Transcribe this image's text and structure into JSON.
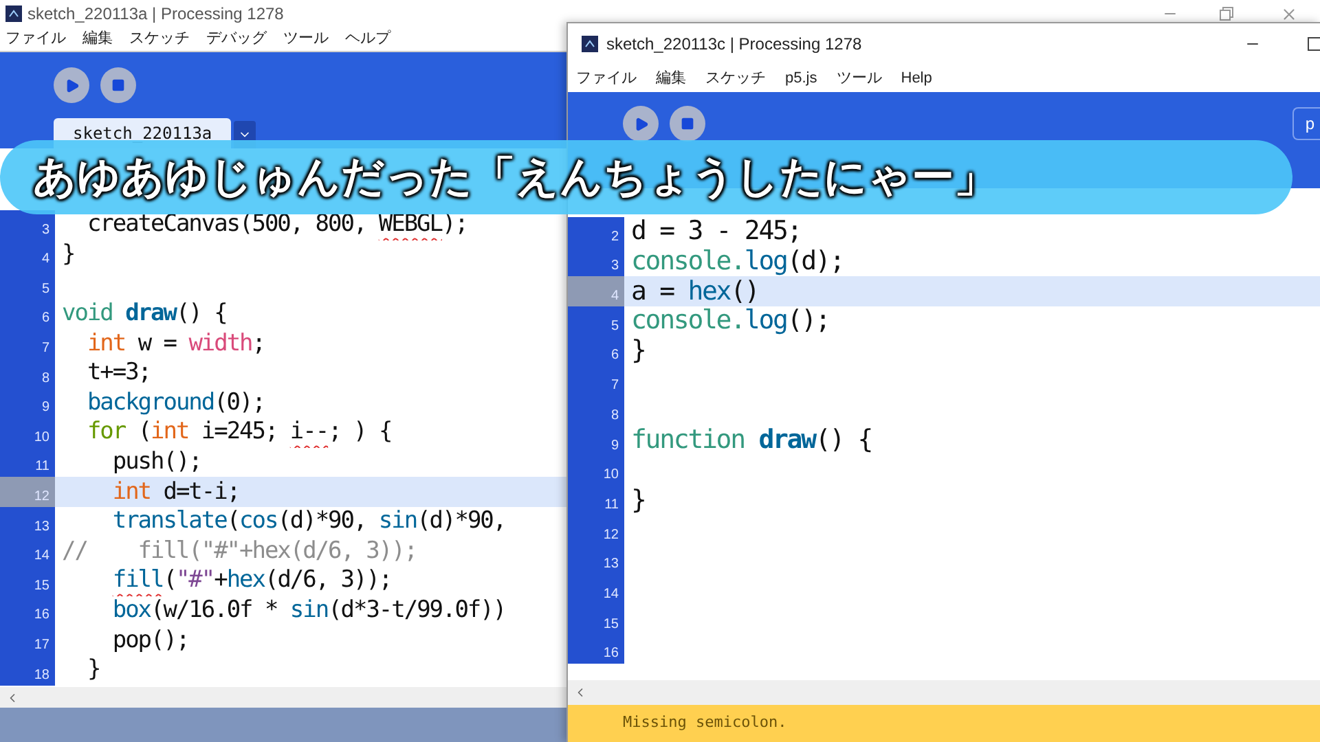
{
  "back_window": {
    "title": "sketch_220113a | Processing 1278",
    "menu": [
      "ファイル",
      "編集",
      "スケッチ",
      "デバッグ",
      "ツール",
      "ヘルプ"
    ],
    "tab": {
      "label": "sketch_220113a",
      "selected": true
    },
    "lines": [
      {
        "number": "3",
        "current": false,
        "segments": [
          {
            "kind": "plain",
            "text": "  createCanvas(500, 800, "
          },
          {
            "kind": "plain",
            "text": "WEBGL",
            "error": true
          },
          {
            "kind": "plain",
            "text": ");"
          }
        ]
      },
      {
        "number": "4",
        "current": false,
        "segments": [
          {
            "kind": "plain",
            "text": "}"
          }
        ]
      },
      {
        "number": "5",
        "current": false
      },
      {
        "number": "6",
        "current": false,
        "segments": [
          {
            "kind": "keyword",
            "text": "void "
          },
          {
            "kind": "definition",
            "text": "draw"
          },
          {
            "kind": "plain",
            "text": "() {"
          }
        ]
      },
      {
        "number": "7",
        "current": false,
        "segments": [
          {
            "kind": "type",
            "text": "  int"
          },
          {
            "kind": "plain",
            "text": " w = "
          },
          {
            "kind": "constant",
            "text": "width"
          },
          {
            "kind": "plain",
            "text": ";"
          }
        ]
      },
      {
        "number": "8",
        "current": false,
        "segments": [
          {
            "kind": "plain",
            "text": "  t+=3;"
          }
        ]
      },
      {
        "number": "9",
        "current": false,
        "segments": [
          {
            "kind": "function",
            "text": "  background"
          },
          {
            "kind": "plain",
            "text": "(0);"
          }
        ]
      },
      {
        "number": "10",
        "current": false,
        "segments": [
          {
            "kind": "control",
            "text": "  for"
          },
          {
            "kind": "plain",
            "text": " ("
          },
          {
            "kind": "type",
            "text": "int"
          },
          {
            "kind": "plain",
            "text": " i=245; "
          },
          {
            "kind": "plain",
            "text": "i--",
            "error": true
          },
          {
            "kind": "plain",
            "text": "; ) {"
          }
        ]
      },
      {
        "number": "11",
        "current": false,
        "segments": [
          {
            "kind": "plain",
            "text": "    push();"
          }
        ]
      },
      {
        "number": "12",
        "current": true,
        "segments": [
          {
            "kind": "type",
            "text": "    int"
          },
          {
            "kind": "plain",
            "text": " d=t-i;"
          }
        ]
      },
      {
        "number": "13",
        "current": false,
        "segments": [
          {
            "kind": "function",
            "text": "    translate"
          },
          {
            "kind": "plain",
            "text": "("
          },
          {
            "kind": "function",
            "text": "cos"
          },
          {
            "kind": "plain",
            "text": "(d)*90, "
          },
          {
            "kind": "function",
            "text": "sin"
          },
          {
            "kind": "plain",
            "text": "(d)*90,"
          }
        ]
      },
      {
        "number": "14",
        "current": false,
        "segments": [
          {
            "kind": "comment",
            "text": "//    fill(\"#\"+hex(d/6, 3));"
          }
        ]
      },
      {
        "number": "15",
        "current": false,
        "segments": [
          {
            "kind": "function",
            "text": "    fill",
            "error": true
          },
          {
            "kind": "plain",
            "text": "("
          },
          {
            "kind": "string",
            "text": "\"#\""
          },
          {
            "kind": "plain",
            "text": "+"
          },
          {
            "kind": "function",
            "text": "hex"
          },
          {
            "kind": "plain",
            "text": "(d/6, 3));"
          }
        ]
      },
      {
        "number": "16",
        "current": false,
        "segments": [
          {
            "kind": "function",
            "text": "    box"
          },
          {
            "kind": "plain",
            "text": "(w/16.0f * "
          },
          {
            "kind": "function",
            "text": "sin"
          },
          {
            "kind": "plain",
            "text": "(d*3-t/99.0f))"
          }
        ]
      },
      {
        "number": "17",
        "current": false,
        "segments": [
          {
            "kind": "plain",
            "text": "    pop();"
          }
        ]
      },
      {
        "number": "18",
        "current": false,
        "segments": [
          {
            "kind": "plain",
            "text": "  }"
          }
        ]
      }
    ]
  },
  "front_window": {
    "title": "sketch_220113c | Processing 1278",
    "menu": [
      "ファイル",
      "編集",
      "スケッチ",
      "p5.js",
      "ツール",
      "Help"
    ],
    "mode_button": "p",
    "lines": [
      {
        "number": "2",
        "current": false,
        "segments": [
          {
            "kind": "plain",
            "text": "d = 3 - 245;"
          }
        ]
      },
      {
        "number": "3",
        "current": false,
        "segments": [
          {
            "kind": "keyword",
            "text": "console."
          },
          {
            "kind": "function",
            "text": "log"
          },
          {
            "kind": "plain",
            "text": "(d);"
          }
        ]
      },
      {
        "number": "4",
        "current": true,
        "segments": [
          {
            "kind": "plain",
            "text": "a = "
          },
          {
            "kind": "function",
            "text": "hex"
          },
          {
            "kind": "plain",
            "text": "()"
          }
        ]
      },
      {
        "number": "5",
        "current": false,
        "segments": [
          {
            "kind": "keyword",
            "text": "console."
          },
          {
            "kind": "function",
            "text": "log"
          },
          {
            "kind": "plain",
            "text": "();"
          }
        ]
      },
      {
        "number": "6",
        "current": false,
        "segments": [
          {
            "kind": "plain",
            "text": "}"
          }
        ]
      },
      {
        "number": "7",
        "current": false
      },
      {
        "number": "8",
        "current": false
      },
      {
        "number": "9",
        "current": false,
        "segments": [
          {
            "kind": "keyword",
            "text": "function "
          },
          {
            "kind": "definition",
            "text": "draw"
          },
          {
            "kind": "plain",
            "text": "() {"
          }
        ]
      },
      {
        "number": "10",
        "current": false
      },
      {
        "number": "11",
        "current": false,
        "segments": [
          {
            "kind": "plain",
            "text": "}"
          }
        ]
      },
      {
        "number": "12",
        "current": false
      },
      {
        "number": "13",
        "current": false
      },
      {
        "number": "14",
        "current": false
      },
      {
        "number": "15",
        "current": false
      },
      {
        "number": "16",
        "current": false
      }
    ],
    "status": {
      "kind": "warning",
      "message": "Missing semicolon."
    }
  },
  "caption": {
    "text": "あゆあゆじゅんだった「えんちょうしたにゃー」"
  }
}
